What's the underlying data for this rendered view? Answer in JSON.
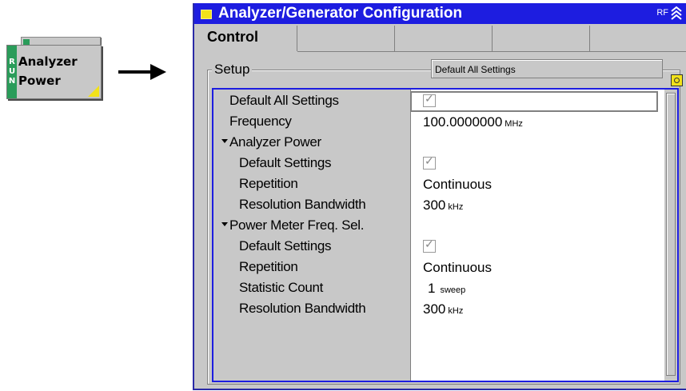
{
  "softkey": {
    "run_letters": [
      "R",
      "U",
      "N"
    ],
    "line1": "Analyzer",
    "line2": "Power"
  },
  "dialog": {
    "title": "Analyzer/Generator Configuration",
    "rf_label": "RF",
    "tabs": [
      {
        "label": "Control",
        "active": true
      },
      {
        "label": ""
      },
      {
        "label": ""
      },
      {
        "label": ""
      },
      {
        "label": ""
      }
    ],
    "group_label": "Setup",
    "default_field": "Default All Settings"
  },
  "rows": [
    {
      "name": "Default All Settings",
      "value": "",
      "checkbox": true,
      "indent": 0
    },
    {
      "name": "Frequency",
      "value": "100.0000000",
      "unit": "MHz",
      "indent": 0
    },
    {
      "name": "Analyzer Power",
      "value": "",
      "group": true,
      "indent": 0
    },
    {
      "name": "Default Settings",
      "value": "",
      "checkbox": true,
      "indent": 1
    },
    {
      "name": "Repetition",
      "value": "Continuous",
      "indent": 1
    },
    {
      "name": "Resolution Bandwidth",
      "value": "300",
      "unit": "kHz",
      "indent": 1
    },
    {
      "name": "Power Meter Freq. Sel.",
      "value": "",
      "group": true,
      "indent": 0
    },
    {
      "name": "Default Settings",
      "value": "",
      "checkbox": true,
      "indent": 1
    },
    {
      "name": "Repetition",
      "value": "Continuous",
      "indent": 1
    },
    {
      "name": "Statistic Count",
      "value": "1",
      "unit": "sweep",
      "indent": 1
    },
    {
      "name": "Resolution Bandwidth",
      "value": "300",
      "unit": "kHz",
      "indent": 1
    }
  ],
  "colors": {
    "title_bar": "#1d1de0",
    "panel_border": "#1d1de0",
    "run_tab": "#2a9c5a",
    "accent_yellow": "#f2e21a"
  }
}
